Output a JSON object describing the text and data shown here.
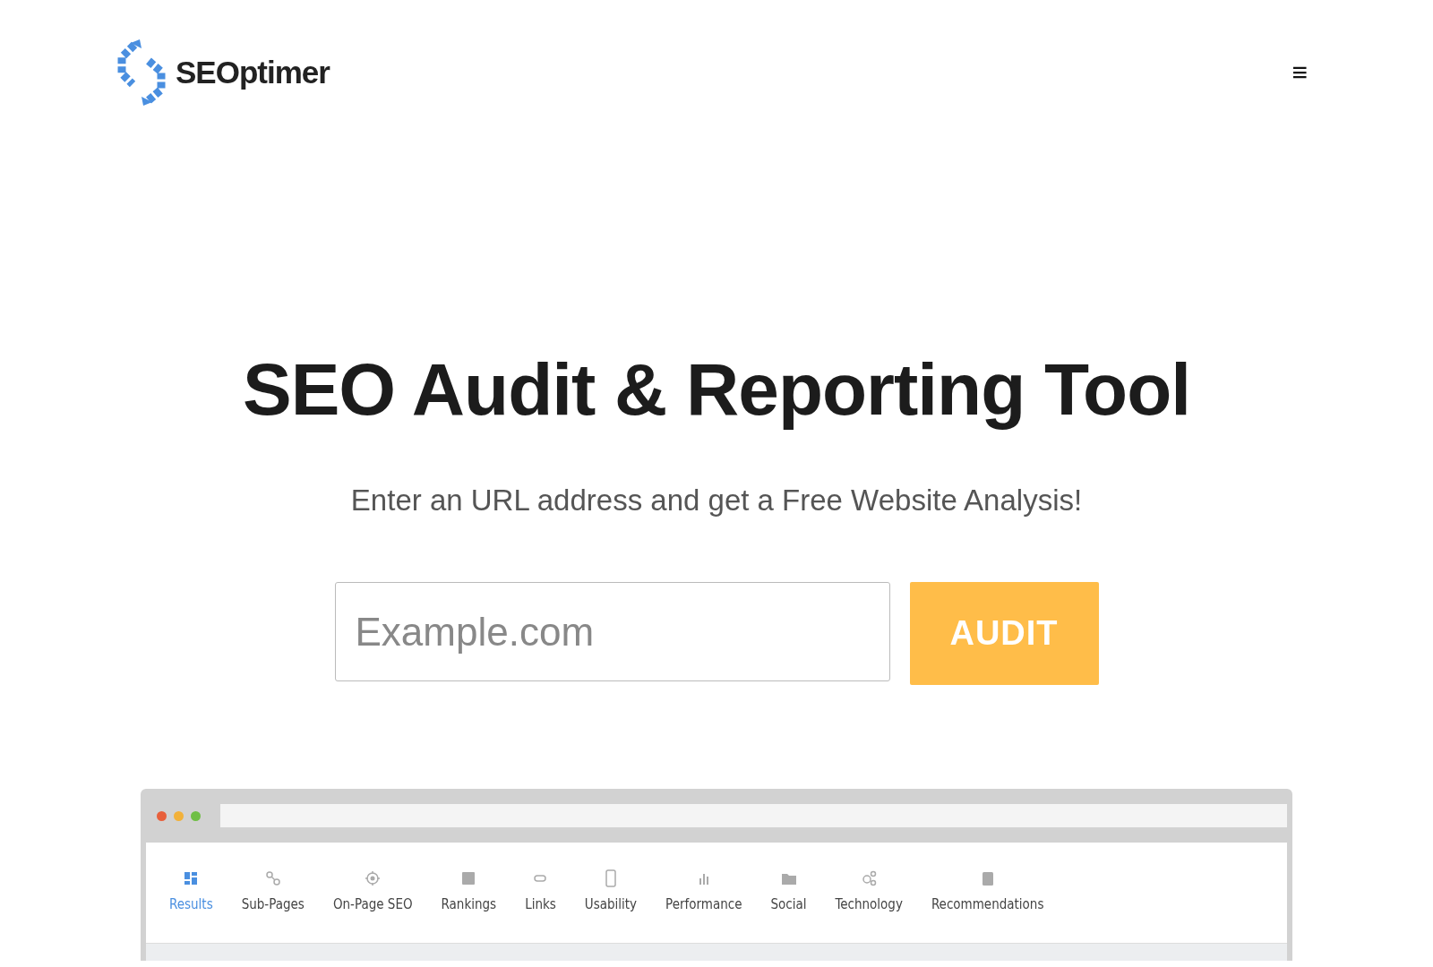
{
  "header": {
    "logo_text": "SEOptimer",
    "menu_icon": "≡"
  },
  "hero": {
    "title": "SEO Audit & Reporting Tool",
    "subtitle": "Enter an URL address and get a Free Website Analysis!",
    "search": {
      "placeholder": "Example.com"
    },
    "button": "AUDIT"
  },
  "preview": {
    "tabs": [
      {
        "label": "Results",
        "kind": "grid",
        "selected": true
      },
      {
        "label": "Sub-Pages",
        "kind": "nodes",
        "selected": false
      },
      {
        "label": "On-Page SEO",
        "kind": "target",
        "selected": false
      },
      {
        "label": "Rankings",
        "kind": "chart",
        "selected": false
      },
      {
        "label": "Links",
        "kind": "link",
        "selected": false
      },
      {
        "label": "Usability",
        "kind": "phone",
        "selected": false
      },
      {
        "label": "Performance",
        "kind": "bars",
        "selected": false
      },
      {
        "label": "Social",
        "kind": "folder",
        "selected": false
      },
      {
        "label": "Technology",
        "kind": "gears",
        "selected": false
      },
      {
        "label": "Recommendations",
        "kind": "clipboard",
        "selected": false
      }
    ]
  }
}
